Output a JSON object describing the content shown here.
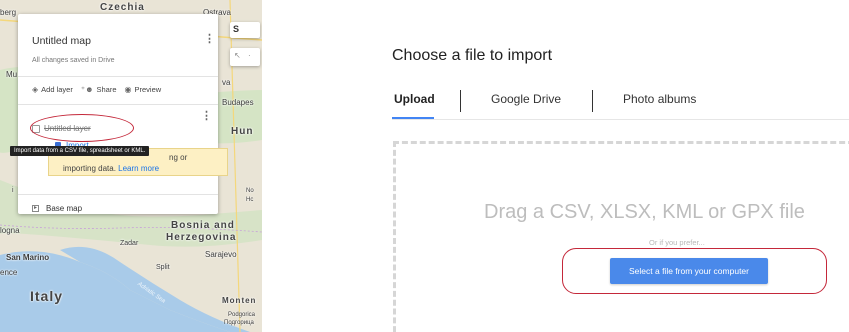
{
  "map": {
    "labels": {
      "czechia": "Czechia",
      "ostrava": "Ostrava",
      "berg": "berg",
      "mu": "Mu",
      "va": "va",
      "budapest": "Budapes",
      "hun": "Hun",
      "no": "No",
      "hc": "Hc",
      "bosnia": "Bosnia and",
      "herzegovina": "Herzegovina",
      "sarajevo": "Sarajevo",
      "zadar": "Zadar",
      "split": "Split",
      "adriatic": "Adriatic Sea",
      "logna": "logna",
      "san_marino": "San Marino",
      "ence": "ence",
      "italy": "Italy",
      "monte": "Monten",
      "podgorica": "Podgorica",
      "podgorica_cyr": "Подгорица",
      "i": "i"
    },
    "colors": {
      "land": "#e9e4d6",
      "water": "#a9cbe9",
      "green": "#cfe3c1"
    }
  },
  "panel": {
    "title": "Untitled map",
    "saved": "All changes saved in Drive",
    "toolbar": {
      "add_layer": "Add layer",
      "share": "Share",
      "preview": "Preview"
    },
    "layer_name": "Untitled layer",
    "import_label": "Import",
    "hint_line1": "ng or",
    "hint_line2": "importing data.",
    "learn_more": "Learn more",
    "base_map": "Base map"
  },
  "tooltip": "Import data from a CSV file, spreadsheet or KML.",
  "dialog": {
    "title": "Choose a file to import",
    "tabs": [
      {
        "label": "Upload",
        "active": true
      },
      {
        "label": "Google Drive",
        "active": false
      },
      {
        "label": "Photo albums",
        "active": false
      }
    ],
    "drag_text": "Drag a CSV, XLSX, KML or GPX file",
    "or_text": "Or if you prefer...",
    "select_button": "Select a file from your computer"
  },
  "accent_colors": {
    "highlight_ellipse": "#c4283a",
    "tab_underline": "#4285f4",
    "button": "#4a89ea"
  }
}
